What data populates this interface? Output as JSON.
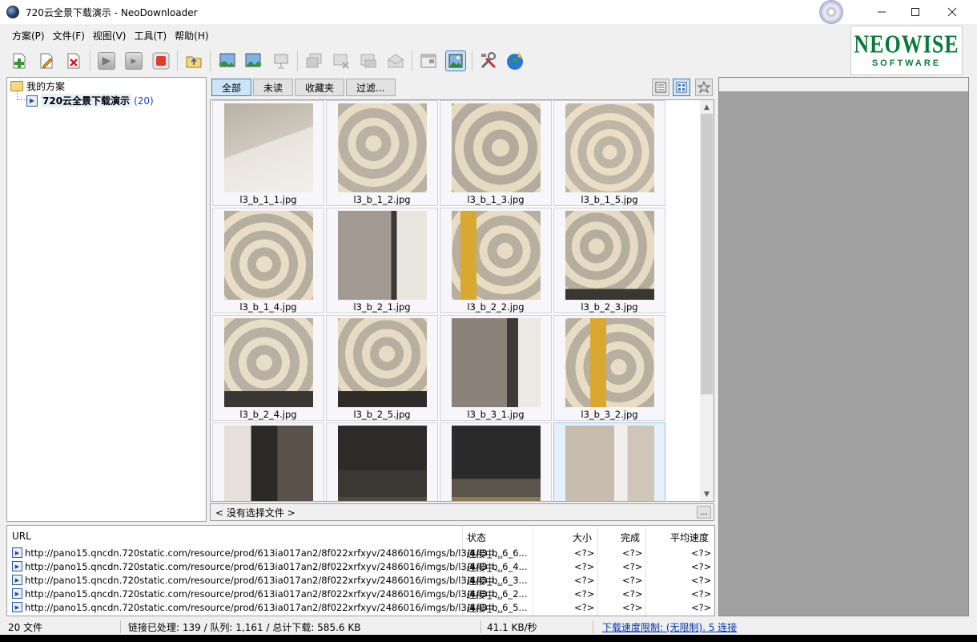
{
  "window": {
    "title": "720云全景下载演示 - NeoDownloader"
  },
  "menu": [
    "方案(P)",
    "文件(F)",
    "视图(V)",
    "工具(T)",
    "帮助(H)"
  ],
  "logo": {
    "main": "NEOWISE",
    "sub": "SOFTWARE"
  },
  "tree": {
    "root": "我的方案",
    "child": {
      "label": "720云全景下载演示",
      "count": "(20)"
    }
  },
  "tabs": [
    "全部",
    "未读",
    "收藏夹",
    "过滤..."
  ],
  "thumbnails": [
    "l3_b_1_1.jpg",
    "l3_b_1_2.jpg",
    "l3_b_1_3.jpg",
    "l3_b_1_5.jpg",
    "l3_b_1_4.jpg",
    "l3_b_2_1.jpg",
    "l3_b_2_2.jpg",
    "l3_b_2_3.jpg",
    "l3_b_2_4.jpg",
    "l3_b_2_5.jpg",
    "l3_b_3_1.jpg",
    "l3_b_3_2.jpg",
    "",
    "",
    "",
    ""
  ],
  "selection_text": "< 没有选择文件 >",
  "more_label": "...",
  "downloads": {
    "headers": {
      "url": "URL",
      "status": "状态",
      "size": "大小",
      "done": "完成",
      "speed": "平均速度"
    },
    "rows": [
      {
        "url": "http://pano15.qncdn.720static.com/resource/prod/613ia017an2/8f022xrfxyv/2486016/imgs/b/l3/4/l3_b_6_6...",
        "status": "连接中...",
        "size": "<?>",
        "done": "<?>",
        "speed": "<?>"
      },
      {
        "url": "http://pano15.qncdn.720static.com/resource/prod/613ia017an2/8f022xrfxyv/2486016/imgs/b/l3/4/l3_b_6_4...",
        "status": "连接中...",
        "size": "<?>",
        "done": "<?>",
        "speed": "<?>"
      },
      {
        "url": "http://pano15.qncdn.720static.com/resource/prod/613ia017an2/8f022xrfxyv/2486016/imgs/b/l3/4/l3_b_6_3...",
        "status": "连接中...",
        "size": "<?>",
        "done": "<?>",
        "speed": "<?>"
      },
      {
        "url": "http://pano15.qncdn.720static.com/resource/prod/613ia017an2/8f022xrfxyv/2486016/imgs/b/l3/4/l3_b_6_2...",
        "status": "连接中...",
        "size": "<?>",
        "done": "<?>",
        "speed": "<?>"
      },
      {
        "url": "http://pano15.qncdn.720static.com/resource/prod/613ia017an2/8f022xrfxyv/2486016/imgs/b/l3/4/l3_b_6_5...",
        "status": "连接中...",
        "size": "<?>",
        "done": "<?>",
        "speed": "<?>"
      }
    ]
  },
  "status": {
    "files": "20 文件",
    "summary": "链接已处理: 139 / 队列: 1,161 / 总计下载: 585.6 KB",
    "rate": "41.1 KB/秒",
    "limit": "下载速度限制: (无限制). 5 连接"
  },
  "colors": {
    "accent": "#cce4f7",
    "accent_border": "#3c7fb1",
    "logo_green": "#0a7a3a",
    "link": "#0033aa"
  }
}
